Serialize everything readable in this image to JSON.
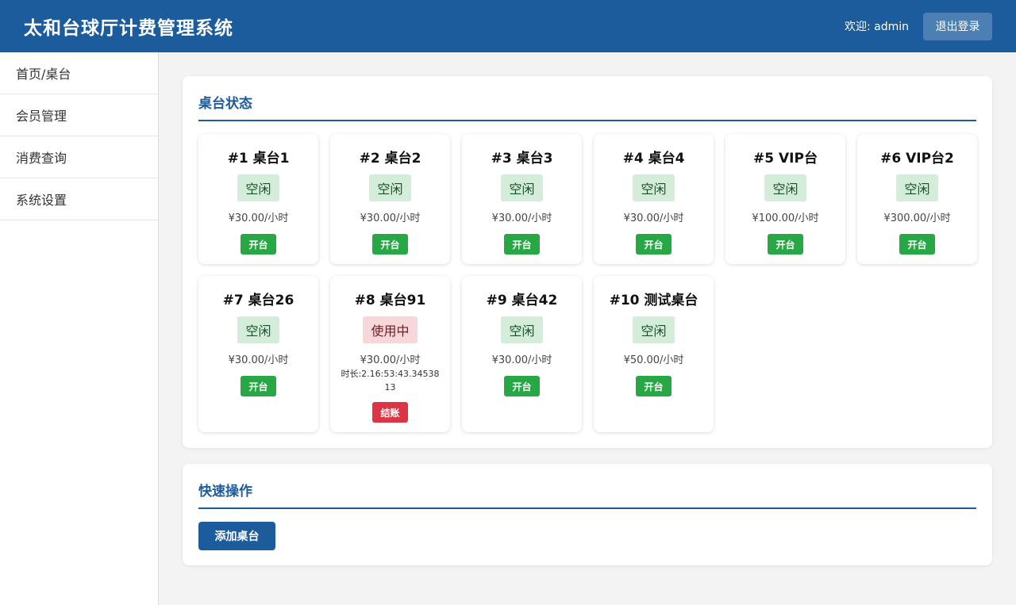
{
  "header": {
    "title": "太和台球厅计费管理系统",
    "welcome": "欢迎: admin",
    "logout_label": "退出登录"
  },
  "sidebar": {
    "items": [
      {
        "label": "首页/桌台"
      },
      {
        "label": "会员管理"
      },
      {
        "label": "消费查询"
      },
      {
        "label": "系统设置"
      }
    ]
  },
  "tables_panel": {
    "title": "桌台状态",
    "tables": [
      {
        "name": "#1 桌台1",
        "status": "空闲",
        "price": "¥30.00/小时",
        "action": "开台"
      },
      {
        "name": "#2 桌台2",
        "status": "空闲",
        "price": "¥30.00/小时",
        "action": "开台"
      },
      {
        "name": "#3 桌台3",
        "status": "空闲",
        "price": "¥30.00/小时",
        "action": "开台"
      },
      {
        "name": "#4 桌台4",
        "status": "空闲",
        "price": "¥30.00/小时",
        "action": "开台"
      },
      {
        "name": "#5 VIP台",
        "status": "空闲",
        "price": "¥100.00/小时",
        "action": "开台"
      },
      {
        "name": "#6 VIP台2",
        "status": "空闲",
        "price": "¥300.00/小时",
        "action": "开台"
      },
      {
        "name": "#7 桌台26",
        "status": "空闲",
        "price": "¥30.00/小时",
        "action": "开台"
      },
      {
        "name": "#8 桌台91",
        "status": "使用中",
        "price": "¥30.00/小时",
        "duration": "时长:2.16:53:43.3453813",
        "action": "结账"
      },
      {
        "name": "#9 桌台42",
        "status": "空闲",
        "price": "¥30.00/小时",
        "action": "开台"
      },
      {
        "name": "#10 测试桌台",
        "status": "空闲",
        "price": "¥50.00/小时",
        "action": "开台"
      }
    ]
  },
  "quick_panel": {
    "title": "快速操作",
    "add_table_label": "添加桌台"
  },
  "colors": {
    "primary": "#1c5b9c",
    "idle_bg": "#d4edda",
    "busy_bg": "#f8d7da",
    "open_button": "#28a745",
    "checkout_button": "#dc3545"
  }
}
